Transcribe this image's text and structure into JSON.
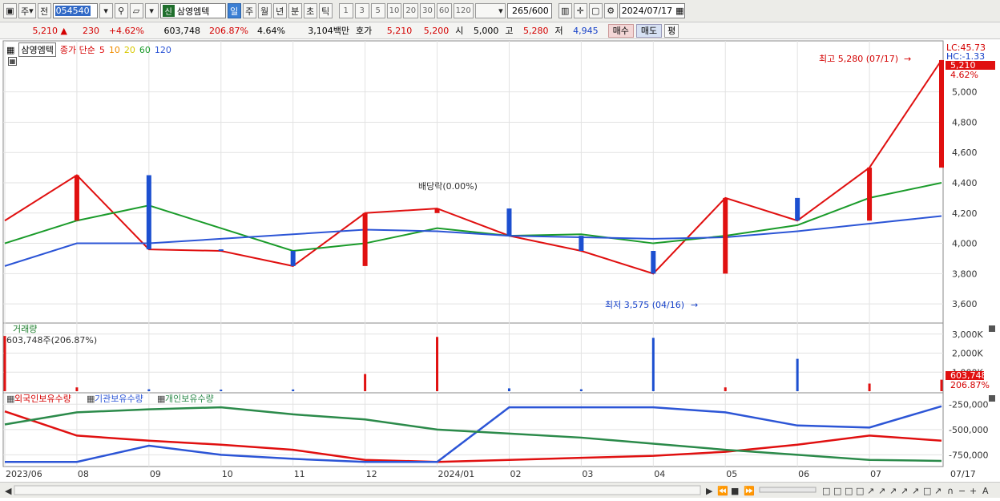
{
  "toolbar": {
    "period_label": "주",
    "prev_label": "전",
    "code": "054540",
    "badge": "신",
    "stock_name": "삼영엠텍",
    "tf_day": "일",
    "tf_week": "주",
    "tf_month": "월",
    "tf_year": "년",
    "tf_min": "분",
    "tf_sec": "초",
    "tf_tick": "틱",
    "intervals": [
      "1",
      "3",
      "5",
      "10",
      "20",
      "30",
      "60",
      "120"
    ],
    "count": "265",
    "count_total": "/600",
    "date": "2024/07/17"
  },
  "info": {
    "price": "5,210",
    "price_arrow": "▲",
    "change": "230",
    "change_pct": "+4.62%",
    "volume": "603,748",
    "volume_ratio": "206.87%",
    "turnover": "4.64%",
    "amount": "3,104백만",
    "quote_label": "호가",
    "ask": "5,210",
    "bid": "5,200",
    "open_label": "시",
    "open": "5,000",
    "high_label": "고",
    "high": "5,280",
    "low_label": "저",
    "low": "4,945",
    "buy_label": "매수",
    "sell_label": "매도",
    "eval_label": "평"
  },
  "price_panel": {
    "title": "삼영엠텍",
    "indicator": "종가 단순",
    "ma_periods": [
      "5",
      "10",
      "20",
      "60",
      "120"
    ],
    "ma_colors": [
      "#e01010",
      "#f08c00",
      "#f2e200",
      "#1a9b2a",
      "#2c55d6"
    ],
    "lc_label": "LC:45.73",
    "hc_label": "HC:-1.33",
    "last_price_tag": "5,210",
    "last_pct_tag": "4.62%",
    "high_annotation": "최고 5,280 (07/17)",
    "low_annotation": "최저 3,575 (04/16)",
    "dividend_annotation": "배당락(0.00%)",
    "y_ticks": [
      "5,000",
      "4,800",
      "4,600",
      "4,400",
      "4,200",
      "4,000",
      "3,800",
      "3,600"
    ]
  },
  "volume_panel": {
    "title": "거래량",
    "value_label": "603,748주(206.87%)",
    "y_ticks": [
      "3,000K",
      "2,000K",
      "1,000K"
    ],
    "last_tag": "603,748",
    "last_pct": "206.87%"
  },
  "holding_panel": {
    "foreign_label": "외국인보유수량",
    "institution_label": "기관보유수량",
    "individual_label": "개인보유수량",
    "y_ticks": [
      "-250,000",
      "-500,000",
      "-750,000"
    ]
  },
  "x_axis": [
    "2023/06",
    "08",
    "09",
    "10",
    "11",
    "12",
    "2024/01",
    "02",
    "03",
    "04",
    "05",
    "06",
    "07",
    "07/17"
  ],
  "colors": {
    "up": "#e01010",
    "down": "#1c4fd0",
    "foreign": "#e01010",
    "institution": "#2c55d6",
    "individual": "#2b8a4a"
  },
  "chart_data": [
    {
      "type": "line",
      "title": "삼영엠텍",
      "x": [
        "2023/06",
        "08",
        "09",
        "10",
        "11",
        "12",
        "2024/01",
        "02",
        "03",
        "04",
        "05",
        "06",
        "07",
        "07/17"
      ],
      "series": [
        {
          "name": "5",
          "values": [
            4150,
            4450,
            3960,
            3950,
            3850,
            4200,
            4230,
            4050,
            3950,
            3800,
            4300,
            4150,
            4500,
            5210
          ]
        },
        {
          "name": "60",
          "values": [
            4000,
            4150,
            4250,
            4100,
            3950,
            4000,
            4100,
            4050,
            4060,
            4000,
            4050,
            4120,
            4300,
            4400
          ]
        },
        {
          "name": "120",
          "values": [
            3850,
            4000,
            4000,
            4030,
            4060,
            4090,
            4080,
            4050,
            4040,
            4030,
            4040,
            4080,
            4130,
            4180
          ]
        }
      ],
      "ylim": [
        3500,
        5300
      ]
    },
    {
      "type": "bar",
      "title": "거래량",
      "x": [
        "2023/06",
        "08",
        "09",
        "10",
        "11",
        "12",
        "2024/01",
        "02",
        "03",
        "04",
        "05",
        "06",
        "07",
        "07/17"
      ],
      "values": [
        2900,
        200,
        100,
        80,
        90,
        900,
        2850,
        150,
        100,
        2800,
        200,
        1700,
        400,
        604
      ],
      "ylim": [
        0,
        3200
      ]
    },
    {
      "type": "line",
      "title": "보유수량",
      "x": [
        "2023/06",
        "08",
        "09",
        "10",
        "11",
        "12",
        "2024/01",
        "02",
        "03",
        "04",
        "05",
        "06",
        "07",
        "07/17"
      ],
      "series": [
        {
          "name": "외국인보유수량",
          "values": [
            -320000,
            -560000,
            -610000,
            -650000,
            -700000,
            -800000,
            -820000,
            -800000,
            -780000,
            -760000,
            -720000,
            -650000,
            -560000,
            -610000
          ]
        },
        {
          "name": "기관보유수량",
          "values": [
            -820000,
            -820000,
            -660000,
            -750000,
            -790000,
            -820000,
            -820000,
            -280000,
            -280000,
            -280000,
            -330000,
            -460000,
            -480000,
            -270000
          ]
        },
        {
          "name": "개인보유수량",
          "values": [
            -450000,
            -330000,
            -300000,
            -280000,
            -350000,
            -400000,
            -500000,
            -540000,
            -580000,
            -640000,
            -700000,
            -750000,
            -800000,
            -810000
          ]
        }
      ],
      "ylim": [
        -850000,
        -200000
      ]
    }
  ]
}
